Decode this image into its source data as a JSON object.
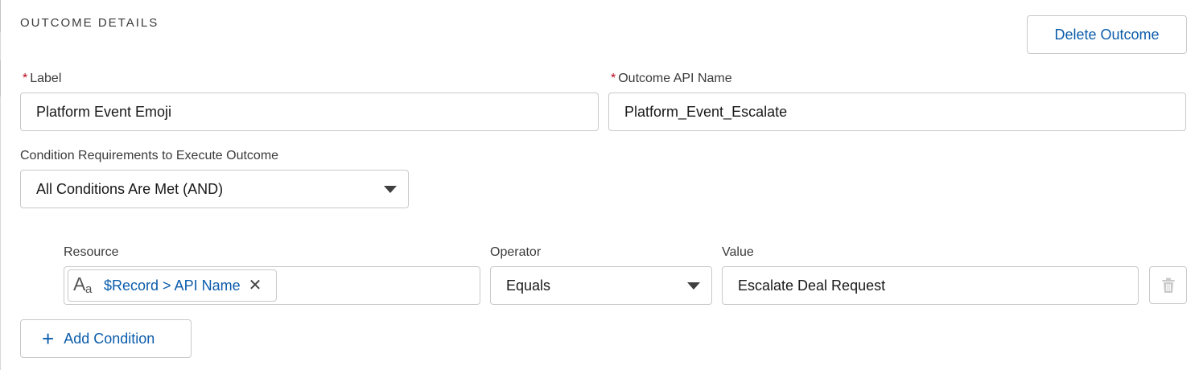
{
  "section": {
    "title": "OUTCOME DETAILS"
  },
  "actions": {
    "delete_label": "Delete Outcome",
    "add_condition_label": "Add Condition"
  },
  "fields": {
    "label": {
      "label": "Label",
      "value": "Platform Event Emoji",
      "required": true
    },
    "api_name": {
      "label": "Outcome API Name",
      "value": "Platform_Event_Escalate",
      "required": true
    },
    "condition_requirements": {
      "label": "Condition Requirements to Execute Outcome",
      "value": "All Conditions Are Met (AND)"
    }
  },
  "condition": {
    "resource_label": "Resource",
    "resource_value": "$Record > API Name",
    "operator_label": "Operator",
    "operator_value": "Equals",
    "value_label": "Value",
    "value_value": "Escalate Deal Request"
  },
  "icons": {
    "text_type": "text-type-icon",
    "remove": "close-icon",
    "delete_condition": "trash-icon",
    "add": "plus-icon",
    "dropdown": "chevron-down-icon"
  },
  "colors": {
    "link_blue": "#0b5cab",
    "required_red": "#ba0517",
    "border": "#c9c9c9"
  }
}
